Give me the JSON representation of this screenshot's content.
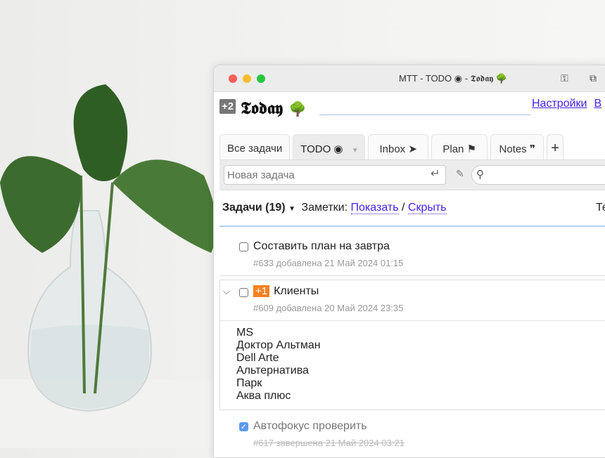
{
  "window": {
    "title": "MTT - TODO ◉ - 𝕿𝖔𝖉𝖆𝖞 🌳",
    "key_icon": "key-icon",
    "extension_icon": "puzzle-icon"
  },
  "header": {
    "badge": "+2",
    "list_name": "𝕿𝖔𝖉𝖆𝖞",
    "list_emoji": "🌳",
    "links": [
      "Настройки",
      "В"
    ]
  },
  "tabs": [
    {
      "label": "Все задачи"
    },
    {
      "label": "TODO ◉",
      "active": true
    },
    {
      "label": "Inbox ➤"
    },
    {
      "label": "Plan ⚑"
    },
    {
      "label": "Notes ❞"
    },
    {
      "label": "+"
    }
  ],
  "toolbar": {
    "new_task_placeholder": "Новая задача",
    "search_value": ""
  },
  "controls": {
    "tasks_label": "Задачи (19)",
    "notes_label": "Заметки:",
    "show": "Показать",
    "slash": "/",
    "hide": "Скрыть",
    "right_text": "Те"
  },
  "tasks": [
    {
      "title": "Составить план на завтра",
      "meta": "#633 добавлена 21 Май 2024 01:15",
      "done": false
    },
    {
      "title": "Клиенты",
      "priority": "+1",
      "meta": "#609 добавлена 20 Май 2024 23:35",
      "done": false,
      "expanded": true,
      "notes": [
        "MS",
        "Доктор Альтман",
        "Dell Arte",
        "Альтернатива",
        "Парк",
        "Аква плюс"
      ]
    },
    {
      "title": "Автофокус проверить",
      "meta": "#617 завершена 21 Май 2024 03:21",
      "done": true
    }
  ],
  "colors": {
    "link": "#4a1ff0",
    "priority": "#f58220",
    "check": "#5b9bf0"
  }
}
